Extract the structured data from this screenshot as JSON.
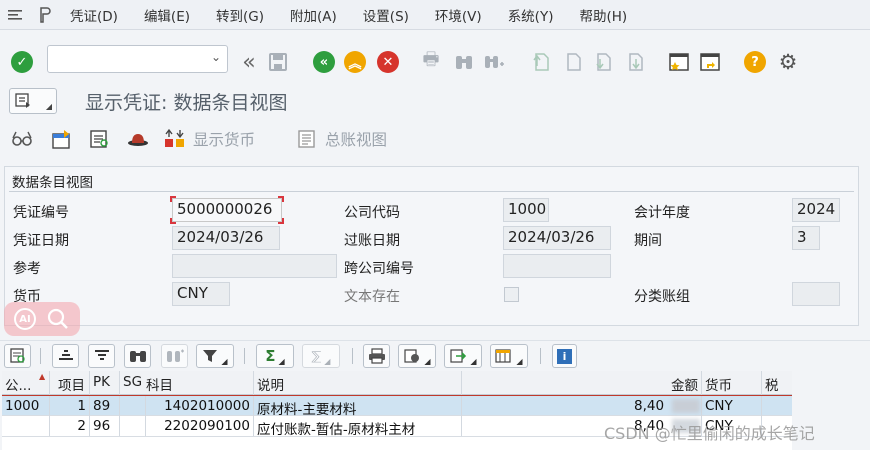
{
  "menubar": {
    "items": [
      "凭证(D)",
      "编辑(E)",
      "转到(G)",
      "附加(A)",
      "设置(S)",
      "环境(V)",
      "系统(Y)",
      "帮助(H)"
    ]
  },
  "toolbar": {
    "command_value": "",
    "icons": [
      "checkmark-icon",
      "back-icon",
      "save-icon",
      "exit-icon",
      "cancel-icon",
      "print-icon",
      "find-icon",
      "find-next-icon",
      "first-page-icon",
      "previous-page-icon",
      "next-page-icon",
      "last-page-icon",
      "new-session-icon",
      "shortcut-icon",
      "help-icon",
      "settings-icon"
    ]
  },
  "title": {
    "text": "显示凭证: 数据条目视图"
  },
  "app_toolbar": {
    "display_currency_label": "显示货币",
    "general_ledger_view_label": "总账视图"
  },
  "header": {
    "group_title": "数据条目视图",
    "doc_number_label": "凭证编号",
    "doc_number_value": "5000000026",
    "company_code_label": "公司代码",
    "company_code_value": "1000",
    "fiscal_year_label": "会计年度",
    "fiscal_year_value": "2024",
    "doc_date_label": "凭证日期",
    "doc_date_value": "2024/03/26",
    "posting_date_label": "过账日期",
    "posting_date_value": "2024/03/26",
    "period_label": "期间",
    "period_value": "3",
    "reference_label": "参考",
    "reference_value": "",
    "cross_company_label": "跨公司编号",
    "cross_company_value": "",
    "currency_label": "货币",
    "currency_value": "CNY",
    "text_exists_label": "文本存在",
    "ledger_group_label": "分类账组",
    "ledger_group_value": ""
  },
  "ai_badge": {
    "label": "AI"
  },
  "grid": {
    "columns": [
      "公...",
      "项目",
      "PK",
      "SG",
      "科目",
      "说明",
      "金额",
      "货币",
      "税"
    ],
    "rows": [
      {
        "company": "1000",
        "item": "1",
        "pk": "89",
        "sg": "",
        "account": "1402010000",
        "description": "原材料-主要材料",
        "amount": "8,40",
        "currency": "CNY",
        "tax": ""
      },
      {
        "company": "",
        "item": "2",
        "pk": "96",
        "sg": "",
        "account": "2202090100",
        "description": "应付账款-暂估-原材料主材",
        "amount": "8,40",
        "currency": "CNY",
        "tax": ""
      }
    ]
  },
  "watermark": {
    "text": "CSDN @忙里偷闲的成长笔记"
  },
  "colors": {
    "accept_green": "#2e9e3e",
    "cancel_red": "#d6342c",
    "exit_orange": "#f0a500",
    "selection_blue": "#cfe3f2"
  }
}
